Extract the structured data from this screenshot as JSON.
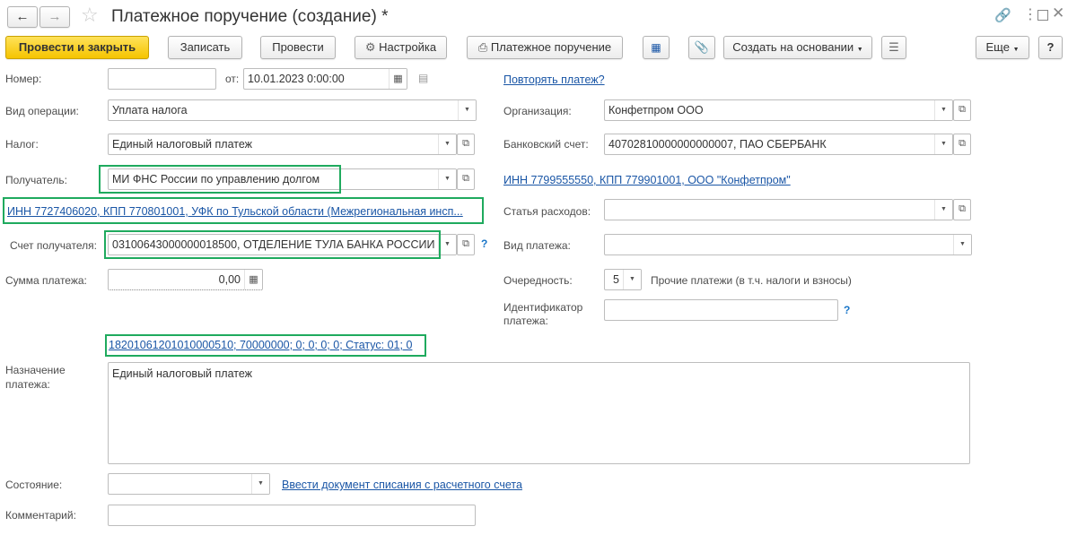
{
  "window": {
    "title": "Платежное поручение (создание) *"
  },
  "toolbar": {
    "post_close": "Провести и закрыть",
    "save": "Записать",
    "post": "Провести",
    "settings": "Настройка",
    "payment_order": "Платежное поручение",
    "create_based": "Создать на основании",
    "more": "Еще",
    "help": "?"
  },
  "form": {
    "number_label": "Номер:",
    "number_value": "",
    "from_label": "от:",
    "date_value": "10.01.2023  0:00:00",
    "repeat_link": "Повторять платеж?",
    "operation_label": "Вид операции:",
    "operation_value": "Уплата налога",
    "organization_label": "Организация:",
    "organization_value": "Конфетпром ООО",
    "tax_label": "Налог:",
    "tax_value": "Единый налоговый платеж",
    "bank_account_label": "Банковский счет:",
    "bank_account_value": "40702810000000000007, ПАО СБЕРБАНК",
    "recipient_label": "Получатель:",
    "recipient_value": "МИ ФНС России по управлению долгом",
    "org_inn_link": "ИНН 7799555550, КПП 779901001, ООО \"Конфетпром\"",
    "recipient_inn_link": "ИНН 7727406020, КПП 770801001, УФК по Тульской области (Межрегиональная инсп...",
    "expense_label": "Статья расходов:",
    "expense_value": "",
    "recipient_account_label": "Счет получателя:",
    "recipient_account_value": "03100643000000018500, ОТДЕЛЕНИЕ ТУЛА БАНКА РОССИИ",
    "payment_type_label": "Вид платежа:",
    "payment_type_value": "",
    "amount_label": "Сумма платежа:",
    "amount_value": "0,00",
    "priority_label": "Очередность:",
    "priority_value": "5",
    "priority_desc": "Прочие платежи (в т.ч. налоги и взносы)",
    "payment_id_label_1": "Идентификатор",
    "payment_id_label_2": "платежа:",
    "payment_id_value": "",
    "budget_link": "18201061201010000510; 70000000; 0; 0; 0; 0; Статус: 01; 0",
    "purpose_label_1": "Назначение",
    "purpose_label_2": "платежа:",
    "purpose_value": "Единый налоговый платеж",
    "state_label": "Состояние:",
    "state_value": "",
    "state_link": "Ввести документ списания с расчетного счета",
    "comment_label": "Комментарий:",
    "comment_value": ""
  },
  "colors": {
    "highlight": "#1faa5e",
    "primary_button": "#f5c400",
    "link": "#1a56a6"
  }
}
